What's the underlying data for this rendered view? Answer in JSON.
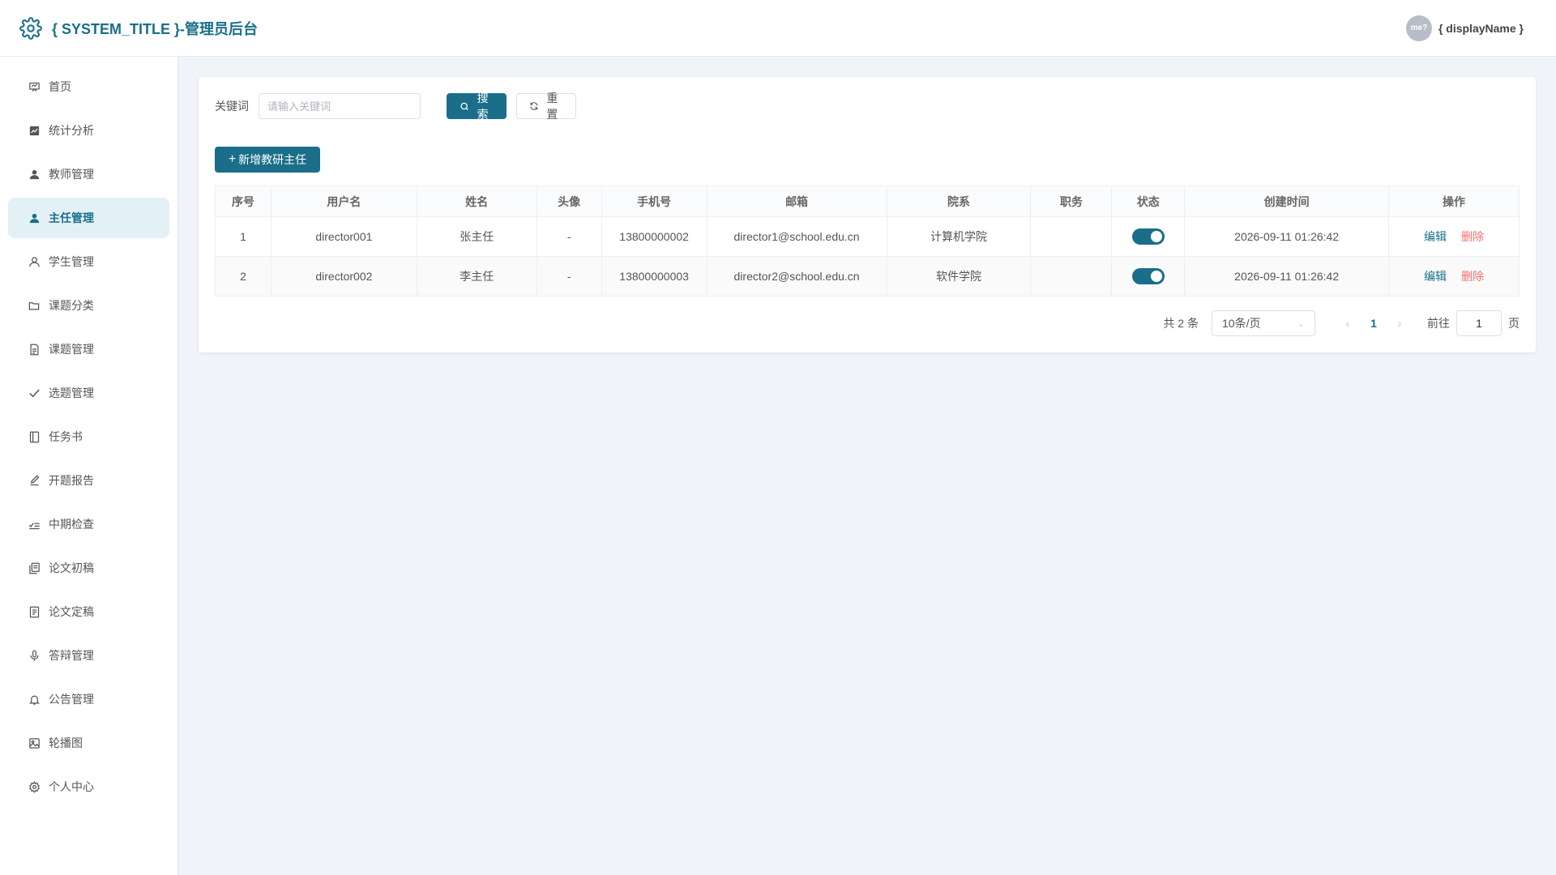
{
  "header": {
    "title": "{ SYSTEM_TITLE }-管理员后台",
    "avatar_text": "me?",
    "display_name": "{ displayName }"
  },
  "sidebar": {
    "items": [
      {
        "label": "首页",
        "icon": "dashboard-icon"
      },
      {
        "label": "统计分析",
        "icon": "chart-icon"
      },
      {
        "label": "教师管理",
        "icon": "user-icon"
      },
      {
        "label": "主任管理",
        "icon": "user-icon",
        "active": true
      },
      {
        "label": "学生管理",
        "icon": "user-outline-icon"
      },
      {
        "label": "课题分类",
        "icon": "folder-icon"
      },
      {
        "label": "课题管理",
        "icon": "document-icon"
      },
      {
        "label": "选题管理",
        "icon": "check-icon"
      },
      {
        "label": "任务书",
        "icon": "notebook-icon"
      },
      {
        "label": "开题报告",
        "icon": "edit-pen-icon"
      },
      {
        "label": "中期检查",
        "icon": "checklist-icon"
      },
      {
        "label": "论文初稿",
        "icon": "copy-document-icon"
      },
      {
        "label": "论文定稿",
        "icon": "tickets-icon"
      },
      {
        "label": "答辩管理",
        "icon": "microphone-icon"
      },
      {
        "label": "公告管理",
        "icon": "bell-icon"
      },
      {
        "label": "轮播图",
        "icon": "picture-icon"
      },
      {
        "label": "个人中心",
        "icon": "setting-icon"
      }
    ]
  },
  "search": {
    "label": "关键词",
    "placeholder": "请输入关键词",
    "value": "",
    "search_button": "搜索",
    "reset_button": "重置"
  },
  "toolbar": {
    "add_button": "新增教研主任"
  },
  "table": {
    "columns": [
      "序号",
      "用户名",
      "姓名",
      "头像",
      "手机号",
      "邮箱",
      "院系",
      "职务",
      "状态",
      "创建时间",
      "操作"
    ],
    "rows": [
      {
        "index": "1",
        "username": "director001",
        "name": "张主任",
        "avatar": "-",
        "phone": "13800000002",
        "email": "director1@school.edu.cn",
        "department": "计算机学院",
        "position": "",
        "status": true,
        "created": "2026-09-11 01:26:42"
      },
      {
        "index": "2",
        "username": "director002",
        "name": "李主任",
        "avatar": "-",
        "phone": "13800000003",
        "email": "director2@school.edu.cn",
        "department": "软件学院",
        "position": "",
        "status": true,
        "created": "2026-09-11 01:26:42"
      }
    ],
    "edit_label": "编辑",
    "delete_label": "删除"
  },
  "pagination": {
    "total_text": "共 2 条",
    "page_size": "10条/页",
    "current_page": "1",
    "goto_label": "前往",
    "goto_value": "1",
    "page_unit": "页"
  },
  "colors": {
    "primary": "#1a6e8a",
    "danger": "#f56c6c",
    "active_bg": "#e3f1f6",
    "page_bg": "#f0f4f8"
  }
}
